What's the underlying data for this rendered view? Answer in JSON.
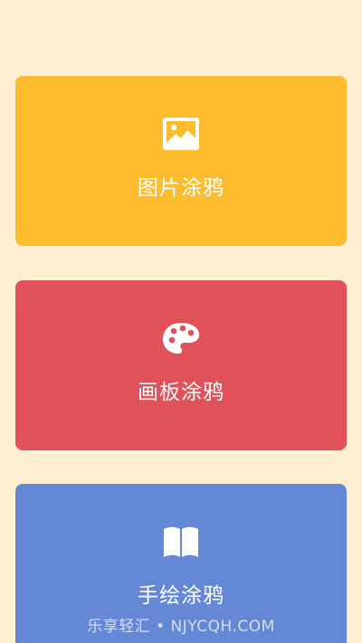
{
  "cards": [
    {
      "label": "图片涂鸦",
      "icon": "image-icon",
      "color": "#fcbc2e"
    },
    {
      "label": "画板涂鸦",
      "icon": "palette-icon",
      "color": "#e0515a"
    },
    {
      "label": "手绘涂鸦",
      "icon": "book-icon",
      "color": "#6487d6"
    }
  ],
  "watermark": "乐享轻汇 • NJYCQH.COM",
  "background_color": "#fdf0d2"
}
